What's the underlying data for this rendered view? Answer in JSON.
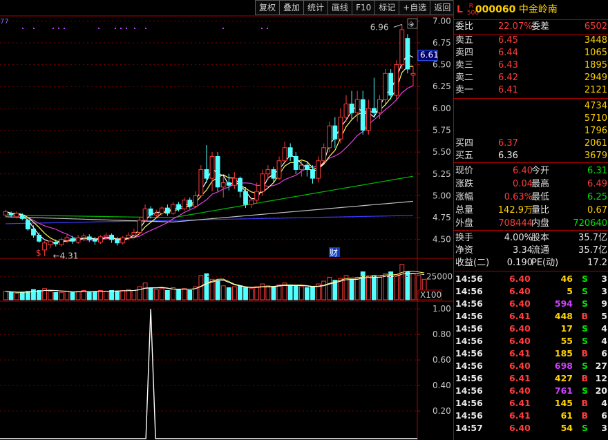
{
  "toolbar": [
    "复权",
    "叠加",
    "统计",
    "画线",
    "F10",
    "标记",
    "+自选",
    "返回"
  ],
  "header": {
    "flag": "L",
    "tag": "R\n500",
    "code": "000060",
    "name": "中金岭南"
  },
  "wei": {
    "bi_label": "委比",
    "bi_value": "22.07%",
    "cha_label": "委差",
    "cha_value": "6502"
  },
  "sell": [
    {
      "label": "卖五",
      "price": "6.45",
      "vol": "3448"
    },
    {
      "label": "卖四",
      "price": "6.44",
      "vol": "1065"
    },
    {
      "label": "卖三",
      "price": "6.43",
      "vol": "1895"
    },
    {
      "label": "卖二",
      "price": "6.42",
      "vol": "2949"
    },
    {
      "label": "卖一",
      "price": "6.41",
      "vol": "2121"
    }
  ],
  "buy": [
    {
      "label": "",
      "price": "",
      "vol": "4734"
    },
    {
      "label": "",
      "price": "",
      "vol": "5710"
    },
    {
      "label": "",
      "price": "",
      "vol": "1796"
    },
    {
      "label": "买四",
      "price": "6.37",
      "vol": "2061"
    },
    {
      "label": "买五",
      "price": "6.36",
      "vol": "3679"
    }
  ],
  "stats": [
    {
      "l1": "现价",
      "v1": "6.40",
      "c1": "red",
      "l2": "今开",
      "v2": "6.31",
      "c2": "grn"
    },
    {
      "l1": "涨跌",
      "v1": "0.04",
      "c1": "red",
      "l2": "最高",
      "v2": "6.49",
      "c2": "red"
    },
    {
      "l1": "涨幅",
      "v1": "0.63%",
      "c1": "red",
      "l2": "最低",
      "v2": "6.25",
      "c2": "grn"
    },
    {
      "l1": "总量",
      "v1": "142.9万",
      "c1": "yel",
      "l2": "量比",
      "v2": "0.67",
      "c2": "yel"
    },
    {
      "l1": "外盘",
      "v1": "708444",
      "c1": "red",
      "l2": "内盘",
      "v2": "720640",
      "c2": "grn"
    }
  ],
  "fund": [
    {
      "l1": "换手",
      "v1": "4.00%",
      "l2": "股本",
      "v2": "35.7亿"
    },
    {
      "l1": "净资",
      "v1": "3.34",
      "l2": "流通",
      "v2": "35.7亿"
    },
    {
      "l1": "收益(二)",
      "v1": "0.190",
      "l2": "PE(动)",
      "v2": "17.2"
    }
  ],
  "ticks": [
    {
      "t": "14:56",
      "p": "6.40",
      "pc": "red",
      "v": "46",
      "vc": "yel",
      "bs": "S",
      "n": "3"
    },
    {
      "t": "14:56",
      "p": "6.40",
      "pc": "red",
      "v": "5",
      "vc": "yel",
      "bs": "S",
      "n": "3"
    },
    {
      "t": "14:56",
      "p": "6.40",
      "pc": "red",
      "v": "594",
      "vc": "mag",
      "bs": "S",
      "n": "9"
    },
    {
      "t": "14:56",
      "p": "6.41",
      "pc": "red",
      "v": "448",
      "vc": "yel",
      "bs": "B",
      "n": "5"
    },
    {
      "t": "14:56",
      "p": "6.40",
      "pc": "red",
      "v": "17",
      "vc": "yel",
      "bs": "S",
      "n": "4"
    },
    {
      "t": "14:56",
      "p": "6.40",
      "pc": "red",
      "v": "55",
      "vc": "yel",
      "bs": "S",
      "n": "4"
    },
    {
      "t": "14:56",
      "p": "6.41",
      "pc": "red",
      "v": "185",
      "vc": "yel",
      "bs": "B",
      "n": "6"
    },
    {
      "t": "14:56",
      "p": "6.40",
      "pc": "red",
      "v": "698",
      "vc": "mag",
      "bs": "S",
      "n": "27"
    },
    {
      "t": "14:56",
      "p": "6.41",
      "pc": "red",
      "v": "427",
      "vc": "yel",
      "bs": "B",
      "n": "12"
    },
    {
      "t": "14:56",
      "p": "6.40",
      "pc": "red",
      "v": "761",
      "vc": "mag",
      "bs": "S",
      "n": "20"
    },
    {
      "t": "14:56",
      "p": "6.41",
      "pc": "red",
      "v": "145",
      "vc": "yel",
      "bs": "B",
      "n": "4"
    },
    {
      "t": "14:56",
      "p": "6.41",
      "pc": "red",
      "v": "61",
      "vc": "yel",
      "bs": "B",
      "n": "6"
    },
    {
      "t": "14:57",
      "p": "6.40",
      "pc": "red",
      "v": "54",
      "vc": "yel",
      "bs": "S",
      "n": "3"
    }
  ],
  "chart_data": {
    "type": "candlestick",
    "price_axis": {
      "ticks": [
        "7.00",
        "6.75",
        "6.50",
        "6.25",
        "6.00",
        "5.75",
        "5.50",
        "5.25",
        "5.00",
        "4.75",
        "4.50"
      ],
      "ylim": [
        4.3,
        7.05
      ]
    },
    "current_price_tag": "6.61",
    "max_annotation": "6.96",
    "min_annotation": "4.31",
    "volume_axis": {
      "tick": "25000",
      "unit": "X100"
    },
    "indicator_axis": {
      "ticks": [
        "1.00",
        "0.80",
        "0.60",
        "0.40",
        "0.20"
      ]
    },
    "event_markers": [
      "$",
      "财"
    ],
    "candles": [
      {
        "o": 4.78,
        "c": 4.82,
        "h": 4.84,
        "l": 4.76
      },
      {
        "o": 4.8,
        "c": 4.78,
        "h": 4.82,
        "l": 4.75
      },
      {
        "o": 4.76,
        "c": 4.8,
        "h": 4.82,
        "l": 4.74
      },
      {
        "o": 4.78,
        "c": 4.74,
        "h": 4.8,
        "l": 4.72
      },
      {
        "o": 4.72,
        "c": 4.62,
        "h": 4.74,
        "l": 4.6
      },
      {
        "o": 4.62,
        "c": 4.55,
        "h": 4.66,
        "l": 4.52
      },
      {
        "o": 4.55,
        "c": 4.48,
        "h": 4.58,
        "l": 4.46
      },
      {
        "o": 4.38,
        "c": 4.46,
        "h": 4.48,
        "l": 4.31
      },
      {
        "o": 4.44,
        "c": 4.48,
        "h": 4.5,
        "l": 4.4
      },
      {
        "o": 4.47,
        "c": 4.45,
        "h": 4.5,
        "l": 4.42
      },
      {
        "o": 4.44,
        "c": 4.5,
        "h": 4.52,
        "l": 4.42
      },
      {
        "o": 4.49,
        "c": 4.52,
        "h": 4.55,
        "l": 4.46
      },
      {
        "o": 4.51,
        "c": 4.48,
        "h": 4.54,
        "l": 4.45
      },
      {
        "o": 4.47,
        "c": 4.52,
        "h": 4.55,
        "l": 4.45
      },
      {
        "o": 4.52,
        "c": 4.54,
        "h": 4.57,
        "l": 4.48
      },
      {
        "o": 4.53,
        "c": 4.5,
        "h": 4.56,
        "l": 4.47
      },
      {
        "o": 4.5,
        "c": 4.48,
        "h": 4.53,
        "l": 4.44
      },
      {
        "o": 4.47,
        "c": 4.53,
        "h": 4.55,
        "l": 4.45
      },
      {
        "o": 4.53,
        "c": 4.55,
        "h": 4.58,
        "l": 4.5
      },
      {
        "o": 4.55,
        "c": 4.5,
        "h": 4.57,
        "l": 4.46
      },
      {
        "o": 4.5,
        "c": 4.46,
        "h": 4.53,
        "l": 4.43
      },
      {
        "o": 4.46,
        "c": 4.52,
        "h": 4.54,
        "l": 4.44
      },
      {
        "o": 4.52,
        "c": 4.55,
        "h": 4.58,
        "l": 4.49
      },
      {
        "o": 4.55,
        "c": 4.58,
        "h": 4.62,
        "l": 4.52
      },
      {
        "o": 4.58,
        "c": 4.72,
        "h": 4.76,
        "l": 4.56
      },
      {
        "o": 4.72,
        "c": 4.85,
        "h": 4.9,
        "l": 4.7
      },
      {
        "o": 4.85,
        "c": 4.78,
        "h": 4.88,
        "l": 4.74
      },
      {
        "o": 4.78,
        "c": 4.8,
        "h": 4.84,
        "l": 4.75
      },
      {
        "o": 4.8,
        "c": 4.86,
        "h": 4.88,
        "l": 4.77
      },
      {
        "o": 4.86,
        "c": 4.8,
        "h": 4.9,
        "l": 4.77
      },
      {
        "o": 4.8,
        "c": 4.9,
        "h": 4.93,
        "l": 4.78
      },
      {
        "o": 4.9,
        "c": 4.85,
        "h": 4.93,
        "l": 4.82
      },
      {
        "o": 4.85,
        "c": 4.95,
        "h": 4.98,
        "l": 4.83
      },
      {
        "o": 4.95,
        "c": 4.88,
        "h": 4.98,
        "l": 4.85
      },
      {
        "o": 4.88,
        "c": 5.0,
        "h": 5.05,
        "l": 4.86
      },
      {
        "o": 5.0,
        "c": 5.3,
        "h": 5.35,
        "l": 4.98
      },
      {
        "o": 5.3,
        "c": 5.2,
        "h": 5.58,
        "l": 5.15
      },
      {
        "o": 5.2,
        "c": 5.45,
        "h": 5.5,
        "l": 5.05
      },
      {
        "o": 5.45,
        "c": 5.1,
        "h": 5.5,
        "l": 5.05
      },
      {
        "o": 5.1,
        "c": 5.15,
        "h": 5.22,
        "l": 4.98
      },
      {
        "o": 5.15,
        "c": 5.12,
        "h": 5.25,
        "l": 5.06
      },
      {
        "o": 5.12,
        "c": 5.2,
        "h": 5.27,
        "l": 5.08
      },
      {
        "o": 5.2,
        "c": 5.05,
        "h": 5.22,
        "l": 4.98
      },
      {
        "o": 5.05,
        "c": 4.9,
        "h": 5.1,
        "l": 4.86
      },
      {
        "o": 4.9,
        "c": 4.95,
        "h": 4.98,
        "l": 4.86
      },
      {
        "o": 4.95,
        "c": 5.05,
        "h": 5.15,
        "l": 4.92
      },
      {
        "o": 5.05,
        "c": 5.25,
        "h": 5.3,
        "l": 5.0
      },
      {
        "o": 5.25,
        "c": 5.3,
        "h": 5.35,
        "l": 5.18
      },
      {
        "o": 5.3,
        "c": 5.2,
        "h": 5.33,
        "l": 5.15
      },
      {
        "o": 5.2,
        "c": 5.4,
        "h": 5.45,
        "l": 5.18
      },
      {
        "o": 5.4,
        "c": 5.55,
        "h": 5.62,
        "l": 5.38
      },
      {
        "o": 5.55,
        "c": 5.45,
        "h": 5.6,
        "l": 5.4
      },
      {
        "o": 5.45,
        "c": 5.3,
        "h": 5.5,
        "l": 5.25
      },
      {
        "o": 5.3,
        "c": 5.35,
        "h": 5.4,
        "l": 5.22
      },
      {
        "o": 5.35,
        "c": 5.3,
        "h": 5.38,
        "l": 5.22
      },
      {
        "o": 5.3,
        "c": 5.2,
        "h": 5.35,
        "l": 5.14
      },
      {
        "o": 5.2,
        "c": 5.4,
        "h": 5.45,
        "l": 5.15
      },
      {
        "o": 5.4,
        "c": 5.55,
        "h": 5.6,
        "l": 5.38
      },
      {
        "o": 5.55,
        "c": 5.8,
        "h": 5.85,
        "l": 5.5
      },
      {
        "o": 5.8,
        "c": 5.65,
        "h": 5.9,
        "l": 5.55
      },
      {
        "o": 5.65,
        "c": 5.9,
        "h": 6.0,
        "l": 5.6
      },
      {
        "o": 5.9,
        "c": 6.05,
        "h": 6.15,
        "l": 5.85
      },
      {
        "o": 6.05,
        "c": 5.95,
        "h": 6.2,
        "l": 5.88
      },
      {
        "o": 5.95,
        "c": 6.1,
        "h": 6.2,
        "l": 5.85
      },
      {
        "o": 6.1,
        "c": 5.75,
        "h": 6.2,
        "l": 5.7
      },
      {
        "o": 5.75,
        "c": 6.0,
        "h": 6.1,
        "l": 5.7
      },
      {
        "o": 6.0,
        "c": 5.95,
        "h": 6.35,
        "l": 5.9
      },
      {
        "o": 5.95,
        "c": 6.1,
        "h": 6.15,
        "l": 5.88
      },
      {
        "o": 6.1,
        "c": 6.4,
        "h": 6.45,
        "l": 6.05
      },
      {
        "o": 6.4,
        "c": 6.15,
        "h": 6.45,
        "l": 6.1
      },
      {
        "o": 6.15,
        "c": 6.5,
        "h": 6.55,
        "l": 6.1
      },
      {
        "o": 6.5,
        "c": 6.9,
        "h": 6.96,
        "l": 6.45
      },
      {
        "o": 6.8,
        "c": 6.45,
        "h": 6.85,
        "l": 6.4
      },
      {
        "o": 6.38,
        "c": 6.4,
        "h": 6.49,
        "l": 6.25
      }
    ],
    "volume": [
      9,
      8,
      7,
      8,
      9,
      11,
      10,
      12,
      9,
      8,
      8,
      9,
      8,
      9,
      10,
      8,
      9,
      10,
      9,
      10,
      9,
      10,
      11,
      10,
      14,
      18,
      12,
      11,
      12,
      10,
      13,
      11,
      12,
      10,
      14,
      26,
      28,
      22,
      20,
      15,
      13,
      14,
      15,
      13,
      12,
      14,
      17,
      15,
      14,
      16,
      18,
      16,
      15,
      14,
      13,
      14,
      17,
      20,
      24,
      21,
      23,
      26,
      22,
      24,
      30,
      25,
      26,
      24,
      28,
      30,
      27,
      38,
      30,
      28,
      26,
      22
    ],
    "indicator": {
      "spike_index": 26,
      "spike_value": 1.0
    }
  }
}
